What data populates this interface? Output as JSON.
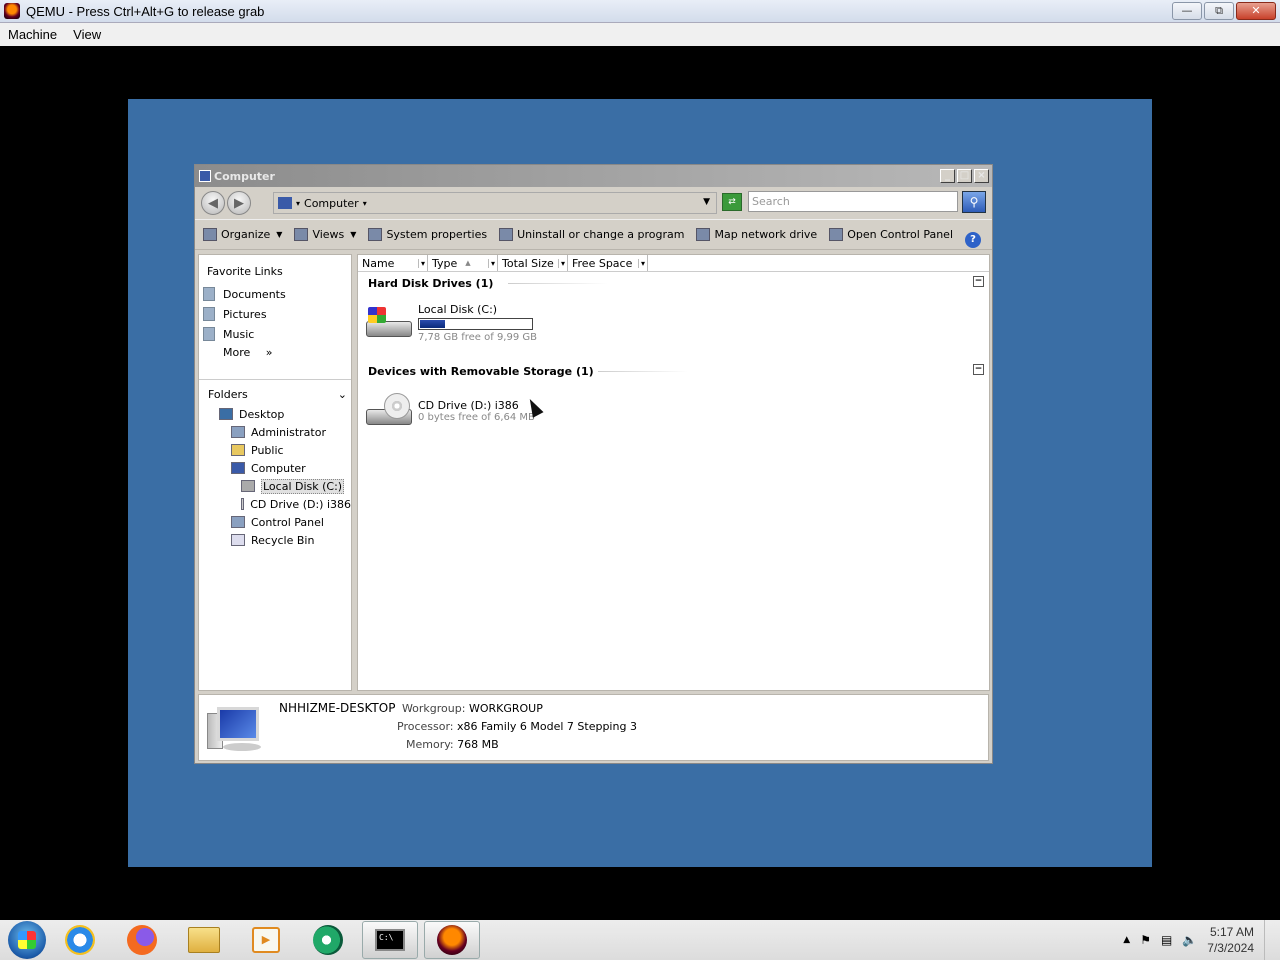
{
  "qemu": {
    "title": "QEMU - Press Ctrl+Alt+G to release grab",
    "menu": [
      "Machine",
      "View"
    ],
    "buttons": [
      "—",
      "⧉",
      "✕"
    ]
  },
  "window": {
    "title": "Computer",
    "controls": [
      "_",
      "□",
      "×"
    ]
  },
  "address": {
    "path": "Computer",
    "search_placeholder": "Search"
  },
  "toolbar": {
    "organize": "Organize",
    "views": "Views",
    "system_properties": "System properties",
    "uninstall": "Uninstall or change a program",
    "map_network": "Map network drive",
    "control_panel": "Open Control Panel",
    "help": "?"
  },
  "favorites": {
    "heading": "Favorite Links",
    "items": [
      "Documents",
      "Pictures",
      "Music"
    ],
    "more": "More",
    "more_arrow": "»"
  },
  "folders": {
    "heading": "Folders",
    "tree": [
      "Desktop",
      "Administrator",
      "Public",
      "Computer",
      "Local Disk (C:)",
      "CD Drive (D:) i386",
      "Control Panel",
      "Recycle Bin"
    ]
  },
  "columns": [
    "Name",
    "Type",
    "Total Size",
    "Free Space"
  ],
  "groups": {
    "hdd": "Hard Disk Drives (1)",
    "removable": "Devices with Removable Storage (1)"
  },
  "drives": {
    "c": {
      "name": "Local Disk (C:)",
      "free": "7,78 GB free of 9,99 GB",
      "used_fraction": 0.22
    },
    "d": {
      "name": "CD Drive (D:) i386",
      "free": "0 bytes free of 6,64 MB"
    }
  },
  "details": {
    "computer": "NHHIZME-DESKTOP",
    "workgroup_label": "Workgroup:",
    "workgroup": "WORKGROUP",
    "processor_label": "Processor:",
    "processor": "x86 Family 6 Model 7 Stepping 3",
    "memory_label": "Memory:",
    "memory": "768 MB"
  },
  "clock": {
    "time": "5:17 AM",
    "date": "7/3/2024"
  }
}
